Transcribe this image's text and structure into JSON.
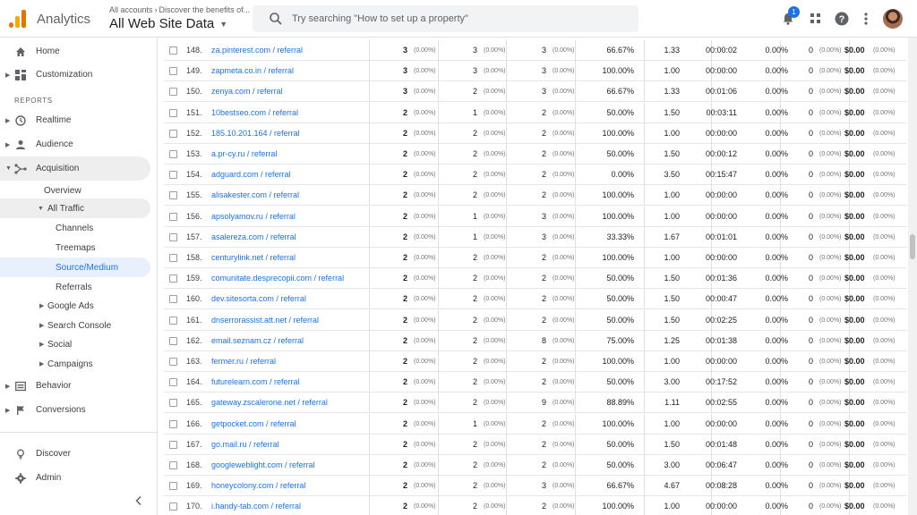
{
  "header": {
    "app_name": "Analytics",
    "account_breadcrumb": [
      "All accounts",
      "Discover the benefits of..."
    ],
    "property_name": "All Web Site Data",
    "search_placeholder": "Try searching \"How to set up a property\"",
    "notification_count": "1"
  },
  "colors": {
    "accent": "#1a73e8",
    "logo_orange": "#f9ab00",
    "logo_dark_orange": "#e37400"
  },
  "sidebar": {
    "home": "Home",
    "customization": "Customization",
    "reports_section": "REPORTS",
    "realtime": "Realtime",
    "audience": "Audience",
    "acquisition": "Acquisition",
    "overview": "Overview",
    "all_traffic": "All Traffic",
    "channels": "Channels",
    "treemaps": "Treemaps",
    "source_medium": "Source/Medium",
    "referrals": "Referrals",
    "google_ads": "Google Ads",
    "search_console": "Search Console",
    "social": "Social",
    "campaigns": "Campaigns",
    "behavior": "Behavior",
    "conversions": "Conversions",
    "discover": "Discover",
    "admin": "Admin"
  },
  "table": {
    "rows": [
      {
        "n": "148.",
        "source": "za.pinterest.com / referral",
        "users": "3",
        "users_pct": "(0.00%)",
        "new_users": "3",
        "new_users_pct": "(0.00%)",
        "sessions": "3",
        "sessions_pct": "(0.00%)",
        "bounce": "66.67%",
        "pages": "1.33",
        "duration": "00:00:02",
        "conv": "0.00%",
        "goal": "0",
        "goal_pct": "(0.00%)",
        "value": "$0.00",
        "value_pct": "(0.00%)"
      },
      {
        "n": "149.",
        "source": "zapmeta.co.in / referral",
        "users": "3",
        "users_pct": "(0.00%)",
        "new_users": "3",
        "new_users_pct": "(0.00%)",
        "sessions": "3",
        "sessions_pct": "(0.00%)",
        "bounce": "100.00%",
        "pages": "1.00",
        "duration": "00:00:00",
        "conv": "0.00%",
        "goal": "0",
        "goal_pct": "(0.00%)",
        "value": "$0.00",
        "value_pct": "(0.00%)"
      },
      {
        "n": "150.",
        "source": "zenya.com / referral",
        "users": "3",
        "users_pct": "(0.00%)",
        "new_users": "2",
        "new_users_pct": "(0.00%)",
        "sessions": "3",
        "sessions_pct": "(0.00%)",
        "bounce": "66.67%",
        "pages": "1.33",
        "duration": "00:01:06",
        "conv": "0.00%",
        "goal": "0",
        "goal_pct": "(0.00%)",
        "value": "$0.00",
        "value_pct": "(0.00%)"
      },
      {
        "n": "151.",
        "source": "10bestseo.com / referral",
        "users": "2",
        "users_pct": "(0.00%)",
        "new_users": "1",
        "new_users_pct": "(0.00%)",
        "sessions": "2",
        "sessions_pct": "(0.00%)",
        "bounce": "50.00%",
        "pages": "1.50",
        "duration": "00:03:11",
        "conv": "0.00%",
        "goal": "0",
        "goal_pct": "(0.00%)",
        "value": "$0.00",
        "value_pct": "(0.00%)"
      },
      {
        "n": "152.",
        "source": "185.10.201.164 / referral",
        "users": "2",
        "users_pct": "(0.00%)",
        "new_users": "2",
        "new_users_pct": "(0.00%)",
        "sessions": "2",
        "sessions_pct": "(0.00%)",
        "bounce": "100.00%",
        "pages": "1.00",
        "duration": "00:00:00",
        "conv": "0.00%",
        "goal": "0",
        "goal_pct": "(0.00%)",
        "value": "$0.00",
        "value_pct": "(0.00%)"
      },
      {
        "n": "153.",
        "source": "a.pr-cy.ru / referral",
        "users": "2",
        "users_pct": "(0.00%)",
        "new_users": "2",
        "new_users_pct": "(0.00%)",
        "sessions": "2",
        "sessions_pct": "(0.00%)",
        "bounce": "50.00%",
        "pages": "1.50",
        "duration": "00:00:12",
        "conv": "0.00%",
        "goal": "0",
        "goal_pct": "(0.00%)",
        "value": "$0.00",
        "value_pct": "(0.00%)"
      },
      {
        "n": "154.",
        "source": "adguard.com / referral",
        "users": "2",
        "users_pct": "(0.00%)",
        "new_users": "2",
        "new_users_pct": "(0.00%)",
        "sessions": "2",
        "sessions_pct": "(0.00%)",
        "bounce": "0.00%",
        "pages": "3.50",
        "duration": "00:15:47",
        "conv": "0.00%",
        "goal": "0",
        "goal_pct": "(0.00%)",
        "value": "$0.00",
        "value_pct": "(0.00%)"
      },
      {
        "n": "155.",
        "source": "alisakester.com / referral",
        "users": "2",
        "users_pct": "(0.00%)",
        "new_users": "2",
        "new_users_pct": "(0.00%)",
        "sessions": "2",
        "sessions_pct": "(0.00%)",
        "bounce": "100.00%",
        "pages": "1.00",
        "duration": "00:00:00",
        "conv": "0.00%",
        "goal": "0",
        "goal_pct": "(0.00%)",
        "value": "$0.00",
        "value_pct": "(0.00%)"
      },
      {
        "n": "156.",
        "source": "apsolyamov.ru / referral",
        "users": "2",
        "users_pct": "(0.00%)",
        "new_users": "1",
        "new_users_pct": "(0.00%)",
        "sessions": "3",
        "sessions_pct": "(0.00%)",
        "bounce": "100.00%",
        "pages": "1.00",
        "duration": "00:00:00",
        "conv": "0.00%",
        "goal": "0",
        "goal_pct": "(0.00%)",
        "value": "$0.00",
        "value_pct": "(0.00%)"
      },
      {
        "n": "157.",
        "source": "asalereza.com / referral",
        "users": "2",
        "users_pct": "(0.00%)",
        "new_users": "1",
        "new_users_pct": "(0.00%)",
        "sessions": "3",
        "sessions_pct": "(0.00%)",
        "bounce": "33.33%",
        "pages": "1.67",
        "duration": "00:01:01",
        "conv": "0.00%",
        "goal": "0",
        "goal_pct": "(0.00%)",
        "value": "$0.00",
        "value_pct": "(0.00%)"
      },
      {
        "n": "158.",
        "source": "centurylink.net / referral",
        "users": "2",
        "users_pct": "(0.00%)",
        "new_users": "2",
        "new_users_pct": "(0.00%)",
        "sessions": "2",
        "sessions_pct": "(0.00%)",
        "bounce": "100.00%",
        "pages": "1.00",
        "duration": "00:00:00",
        "conv": "0.00%",
        "goal": "0",
        "goal_pct": "(0.00%)",
        "value": "$0.00",
        "value_pct": "(0.00%)"
      },
      {
        "n": "159.",
        "source": "comunitate.desprecopii.com / referral",
        "users": "2",
        "users_pct": "(0.00%)",
        "new_users": "2",
        "new_users_pct": "(0.00%)",
        "sessions": "2",
        "sessions_pct": "(0.00%)",
        "bounce": "50.00%",
        "pages": "1.50",
        "duration": "00:01:36",
        "conv": "0.00%",
        "goal": "0",
        "goal_pct": "(0.00%)",
        "value": "$0.00",
        "value_pct": "(0.00%)"
      },
      {
        "n": "160.",
        "source": "dev.sitesorta.com / referral",
        "users": "2",
        "users_pct": "(0.00%)",
        "new_users": "2",
        "new_users_pct": "(0.00%)",
        "sessions": "2",
        "sessions_pct": "(0.00%)",
        "bounce": "50.00%",
        "pages": "1.50",
        "duration": "00:00:47",
        "conv": "0.00%",
        "goal": "0",
        "goal_pct": "(0.00%)",
        "value": "$0.00",
        "value_pct": "(0.00%)"
      },
      {
        "n": "161.",
        "source": "dnserrorassist.att.net / referral",
        "users": "2",
        "users_pct": "(0.00%)",
        "new_users": "2",
        "new_users_pct": "(0.00%)",
        "sessions": "2",
        "sessions_pct": "(0.00%)",
        "bounce": "50.00%",
        "pages": "1.50",
        "duration": "00:02:25",
        "conv": "0.00%",
        "goal": "0",
        "goal_pct": "(0.00%)",
        "value": "$0.00",
        "value_pct": "(0.00%)"
      },
      {
        "n": "162.",
        "source": "email.seznam.cz / referral",
        "users": "2",
        "users_pct": "(0.00%)",
        "new_users": "2",
        "new_users_pct": "(0.00%)",
        "sessions": "8",
        "sessions_pct": "(0.00%)",
        "bounce": "75.00%",
        "pages": "1.25",
        "duration": "00:01:38",
        "conv": "0.00%",
        "goal": "0",
        "goal_pct": "(0.00%)",
        "value": "$0.00",
        "value_pct": "(0.00%)"
      },
      {
        "n": "163.",
        "source": "fermer.ru / referral",
        "users": "2",
        "users_pct": "(0.00%)",
        "new_users": "2",
        "new_users_pct": "(0.00%)",
        "sessions": "2",
        "sessions_pct": "(0.00%)",
        "bounce": "100.00%",
        "pages": "1.00",
        "duration": "00:00:00",
        "conv": "0.00%",
        "goal": "0",
        "goal_pct": "(0.00%)",
        "value": "$0.00",
        "value_pct": "(0.00%)"
      },
      {
        "n": "164.",
        "source": "futurelearn.com / referral",
        "users": "2",
        "users_pct": "(0.00%)",
        "new_users": "2",
        "new_users_pct": "(0.00%)",
        "sessions": "2",
        "sessions_pct": "(0.00%)",
        "bounce": "50.00%",
        "pages": "3.00",
        "duration": "00:17:52",
        "conv": "0.00%",
        "goal": "0",
        "goal_pct": "(0.00%)",
        "value": "$0.00",
        "value_pct": "(0.00%)"
      },
      {
        "n": "165.",
        "source": "gateway.zscalerone.net / referral",
        "users": "2",
        "users_pct": "(0.00%)",
        "new_users": "2",
        "new_users_pct": "(0.00%)",
        "sessions": "9",
        "sessions_pct": "(0.00%)",
        "bounce": "88.89%",
        "pages": "1.11",
        "duration": "00:02:55",
        "conv": "0.00%",
        "goal": "0",
        "goal_pct": "(0.00%)",
        "value": "$0.00",
        "value_pct": "(0.00%)"
      },
      {
        "n": "166.",
        "source": "getpocket.com / referral",
        "users": "2",
        "users_pct": "(0.00%)",
        "new_users": "1",
        "new_users_pct": "(0.00%)",
        "sessions": "2",
        "sessions_pct": "(0.00%)",
        "bounce": "100.00%",
        "pages": "1.00",
        "duration": "00:00:00",
        "conv": "0.00%",
        "goal": "0",
        "goal_pct": "(0.00%)",
        "value": "$0.00",
        "value_pct": "(0.00%)"
      },
      {
        "n": "167.",
        "source": "go.mail.ru / referral",
        "users": "2",
        "users_pct": "(0.00%)",
        "new_users": "2",
        "new_users_pct": "(0.00%)",
        "sessions": "2",
        "sessions_pct": "(0.00%)",
        "bounce": "50.00%",
        "pages": "1.50",
        "duration": "00:01:48",
        "conv": "0.00%",
        "goal": "0",
        "goal_pct": "(0.00%)",
        "value": "$0.00",
        "value_pct": "(0.00%)"
      },
      {
        "n": "168.",
        "source": "googleweblight.com / referral",
        "users": "2",
        "users_pct": "(0.00%)",
        "new_users": "2",
        "new_users_pct": "(0.00%)",
        "sessions": "2",
        "sessions_pct": "(0.00%)",
        "bounce": "50.00%",
        "pages": "3.00",
        "duration": "00:06:47",
        "conv": "0.00%",
        "goal": "0",
        "goal_pct": "(0.00%)",
        "value": "$0.00",
        "value_pct": "(0.00%)"
      },
      {
        "n": "169.",
        "source": "honeycolony.com / referral",
        "users": "2",
        "users_pct": "(0.00%)",
        "new_users": "2",
        "new_users_pct": "(0.00%)",
        "sessions": "3",
        "sessions_pct": "(0.00%)",
        "bounce": "66.67%",
        "pages": "4.67",
        "duration": "00:08:28",
        "conv": "0.00%",
        "goal": "0",
        "goal_pct": "(0.00%)",
        "value": "$0.00",
        "value_pct": "(0.00%)"
      },
      {
        "n": "170.",
        "source": "i.handy-tab.com / referral",
        "users": "2",
        "users_pct": "(0.00%)",
        "new_users": "2",
        "new_users_pct": "(0.00%)",
        "sessions": "2",
        "sessions_pct": "(0.00%)",
        "bounce": "100.00%",
        "pages": "1.00",
        "duration": "00:00:00",
        "conv": "0.00%",
        "goal": "0",
        "goal_pct": "(0.00%)",
        "value": "$0.00",
        "value_pct": "(0.00%)"
      }
    ]
  }
}
